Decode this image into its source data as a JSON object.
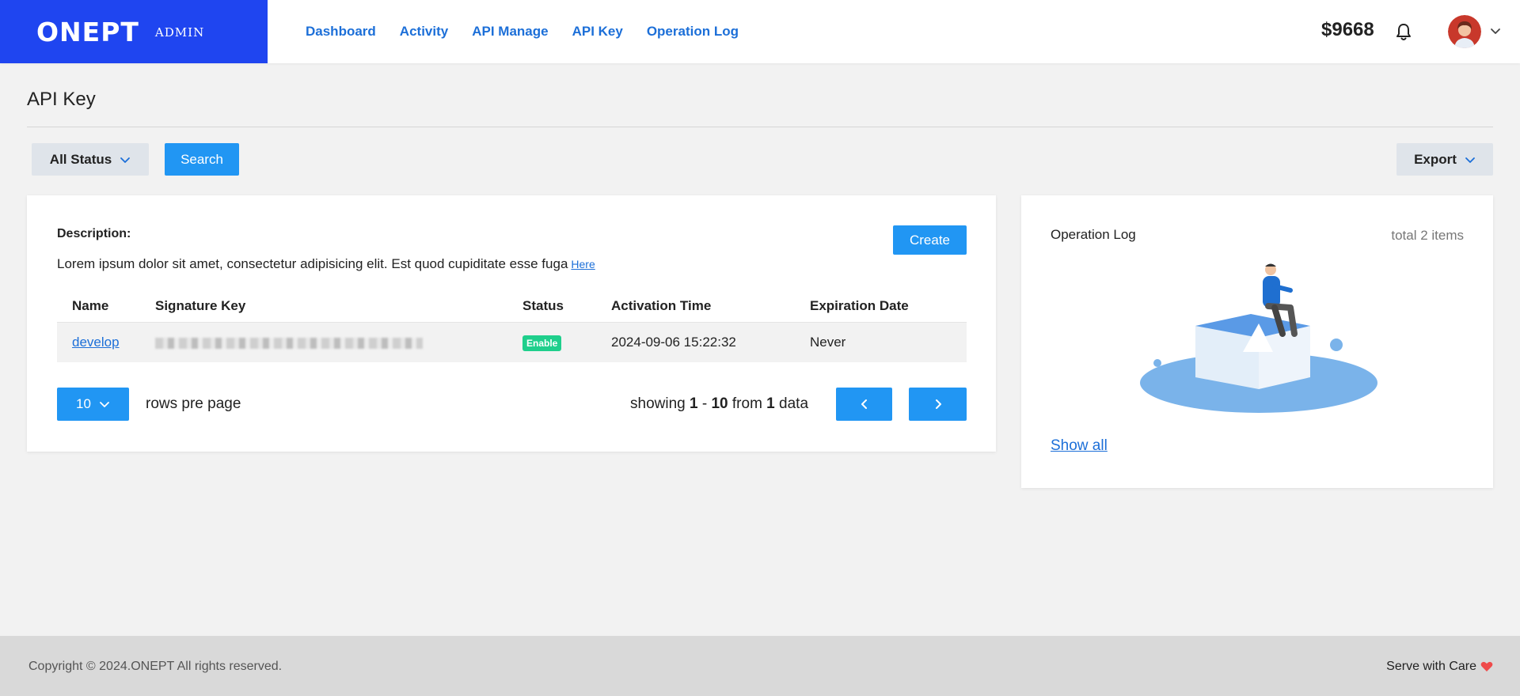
{
  "brand": {
    "logo": "ONEPT",
    "sub": "ADMIN"
  },
  "nav": [
    "Dashboard",
    "Activity",
    "API Manage",
    "API Key",
    "Operation Log"
  ],
  "header": {
    "balance": "$9668"
  },
  "page": {
    "title": "API Key"
  },
  "toolbar": {
    "status_label": "All Status",
    "search_label": "Search",
    "export_label": "Export"
  },
  "main": {
    "desc_label": "Description:",
    "desc_text": "Lorem ipsum dolor sit amet, consectetur adipisicing elit. Est quod cupiditate esse fuga",
    "desc_link": "Here",
    "create_label": "Create",
    "table": {
      "headers": [
        "Name",
        "Signature Key",
        "Status",
        "Activation Time",
        "Expiration Date"
      ],
      "rows": [
        {
          "name": "develop",
          "status": "Enable",
          "activation": "2024-09-06 15:22:32",
          "expiration": "Never"
        }
      ]
    },
    "pager": {
      "page_size": "10",
      "rows_label": "rows pre page",
      "showing_pre": "showing",
      "from_n": "1",
      "sep": "-",
      "to_n": "10",
      "from_word": "from",
      "total_n": "1",
      "data_word": "data"
    }
  },
  "side": {
    "title": "Operation Log",
    "total": "total 2 items",
    "show_all": "Show all"
  },
  "footer": {
    "copyright": "Copyright © 2024.ONEPT All rights reserved.",
    "serve": "Serve with Care"
  },
  "colors": {
    "brand": "#1f45f0",
    "primary": "#2196f3",
    "link": "#1c6fd8",
    "badge": "#1fcf8c",
    "heart": "#ef4b4b"
  },
  "icons": [
    "bell-icon",
    "chevron-down-icon",
    "chevron-left-icon",
    "chevron-right-icon",
    "heart-icon"
  ]
}
